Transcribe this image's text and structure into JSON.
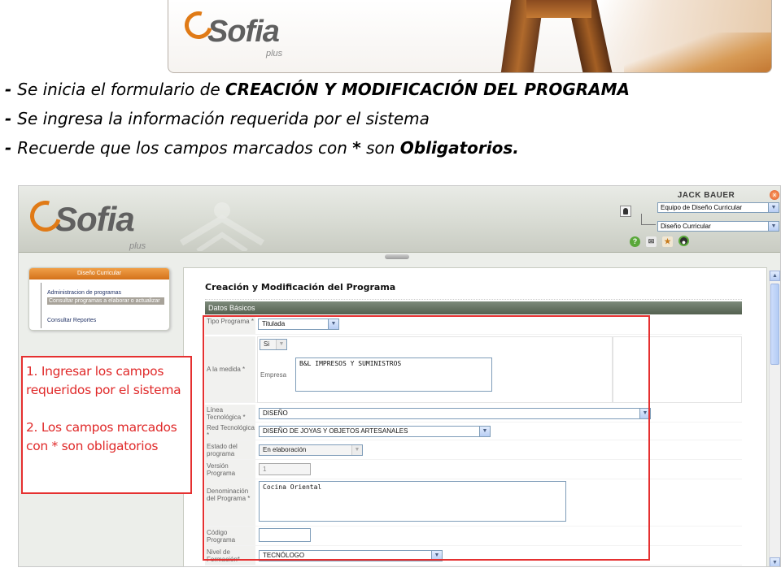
{
  "slide": {
    "brand_word": "Sofia",
    "brand_plus": "plus"
  },
  "instructions": [
    {
      "prefix": "- ",
      "pre": "Se inicia el formulario de ",
      "bold": "CREACIÓN Y MODIFICACIÓN DEL PROGRAMA",
      "post": ""
    },
    {
      "prefix": "- ",
      "pre": "Se ingresa la información requerida por el sistema",
      "bold": "",
      "post": ""
    },
    {
      "prefix": "- ",
      "pre": "Recuerde que los campos marcados con ",
      "bold": "*",
      "mid": " son ",
      "bold2": "Obligatorios.",
      "post": ""
    }
  ],
  "app_header": {
    "brand_word": "Sofia",
    "brand_plus": "plus",
    "user_name": "JACK BAUER",
    "role_select": "Equipo de Diseño Curricular",
    "module_select": "Diseño Curricular",
    "icons": [
      "help-icon",
      "mail-icon",
      "favorites-icon",
      "logout-icon"
    ],
    "accent": "#e07a16"
  },
  "left_menu": {
    "header": "Diseño Curricular",
    "items": [
      "Administracion de programas",
      "Consultar programas a elaborar o actualizar",
      "Consultar Reportes"
    ],
    "selected_index": 1
  },
  "annotation": {
    "line1": "1. Ingresar los campos",
    "line2": "requeridos por el sistema",
    "line3": "2. Los campos marcados",
    "line4": "con * son obligatorios",
    "color": "#e53030"
  },
  "form": {
    "title": "Creación y Modificación del Programa",
    "section": "Datos Básicos",
    "fields": {
      "tipo_label": "Tipo Programa *",
      "tipo_value": "Titulada",
      "medida_label": "A la medida *",
      "medida_value": "Si",
      "empresa_label": "Empresa",
      "empresa_value": "B&L IMPRESOS Y SUMINISTROS",
      "linea_label": "Línea Tecnológica *",
      "linea_value": "DISEÑO",
      "red_label": "Red Tecnológica *",
      "red_value": "DISEÑO DE JOYAS Y OBJETOS ARTESANALES",
      "estado_label": "Estado del programa",
      "estado_value": "En elaboración",
      "version_label": "Versión Programa",
      "version_value": "1",
      "denominacion_label": "Denominación del Programa *",
      "denominacion_value": "Cocina Oriental",
      "codigo_label": "Código Programa",
      "codigo_value": "",
      "nivel_label": "Nivel de Formación*",
      "nivel_value": "TECNÓLOGO"
    }
  }
}
